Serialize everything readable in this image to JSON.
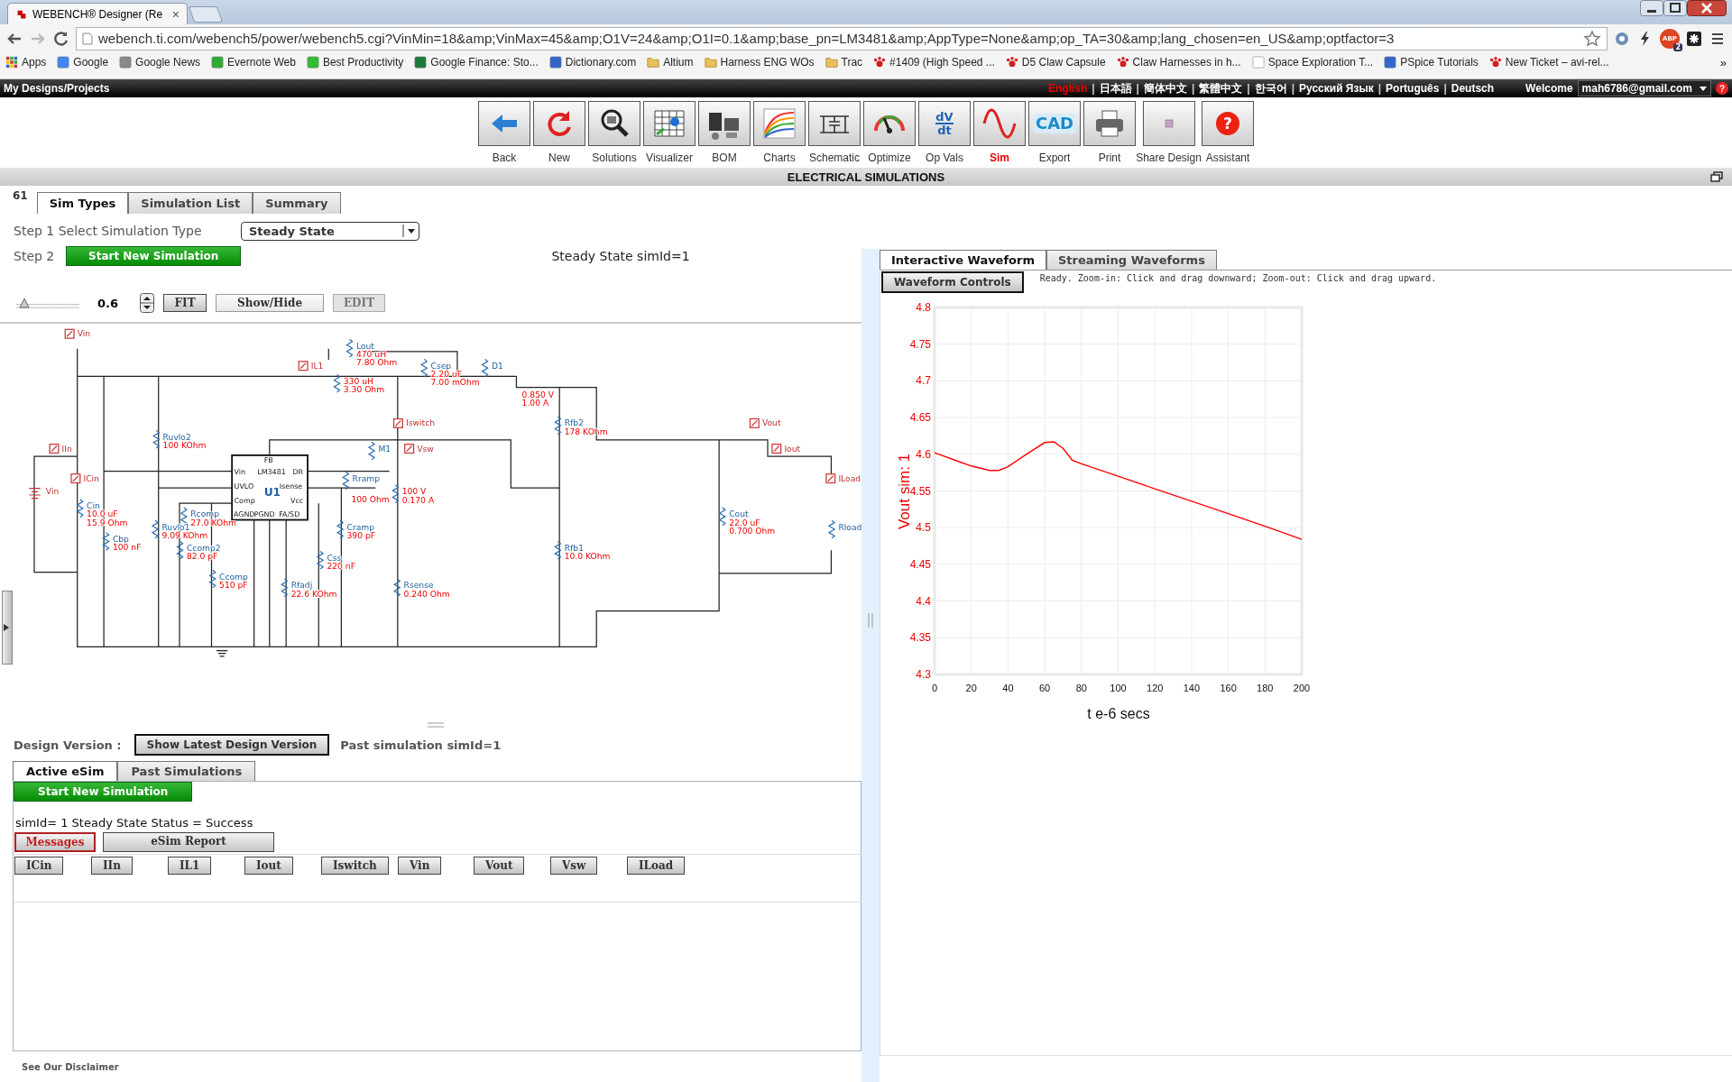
{
  "browser": {
    "tab_title": "WEBENCH® Designer (Re",
    "tab_close": "×",
    "url": "webench.ti.com/webench5/power/webench5.cgi?VinMin=18&amp;VinMax=45&amp;O1V=24&amp;O1I=0.1&amp;base_pn=LM3481&amp;AppType=None&amp;op_TA=30&amp;lang_chosen=en_US&amp;optfactor=3",
    "adblock_label": "ABP",
    "adblock_count": "2",
    "bookmarks": [
      {
        "label": "Apps"
      },
      {
        "label": "Google"
      },
      {
        "label": "Google News"
      },
      {
        "label": "Evernote Web"
      },
      {
        "label": "Best Productivity"
      },
      {
        "label": "Google Finance: Sto..."
      },
      {
        "label": "Dictionary.com"
      },
      {
        "label": "Altium"
      },
      {
        "label": "Harness ENG WOs"
      },
      {
        "label": "Trac"
      },
      {
        "label": "#1409 (High Speed ..."
      },
      {
        "label": "D5 Claw Capsule"
      },
      {
        "label": "Claw Harnesses in h..."
      },
      {
        "label": "Space Exploration T..."
      },
      {
        "label": "PSpice Tutorials"
      },
      {
        "label": "New Ticket – avi-rel..."
      }
    ],
    "bookmarks_more": "»"
  },
  "top_bar": {
    "title": "My Designs/Projects",
    "separator": "|",
    "languages": [
      {
        "label": "English",
        "selected": true
      },
      {
        "label": "日本語",
        "selected": false
      },
      {
        "label": "簡体中文",
        "selected": false
      },
      {
        "label": "繁體中文",
        "selected": false
      },
      {
        "label": "한국어",
        "selected": false
      },
      {
        "label": "Русский Язык",
        "selected": false
      },
      {
        "label": "Português",
        "selected": false
      },
      {
        "label": "Deutsch",
        "selected": false
      }
    ],
    "welcome": "Welcome",
    "account": "mah6786@gmail.com",
    "help_glyph": "?"
  },
  "toolbar": [
    {
      "label": "Back",
      "selected": false
    },
    {
      "label": "New",
      "selected": false
    },
    {
      "label": "Solutions",
      "selected": false
    },
    {
      "label": "Visualizer",
      "selected": false
    },
    {
      "label": "BOM",
      "selected": false
    },
    {
      "label": "Charts",
      "selected": false
    },
    {
      "label": "Schematic",
      "selected": false
    },
    {
      "label": "Optimize",
      "selected": false
    },
    {
      "label": "Op Vals",
      "selected": false,
      "glyph": [
        "dV",
        "dt"
      ]
    },
    {
      "label": "Sim",
      "selected": true
    },
    {
      "label": "Export",
      "selected": false,
      "glyph": [
        "CAD"
      ]
    },
    {
      "label": "Print",
      "selected": false
    },
    {
      "label": "Share Design",
      "selected": false
    },
    {
      "label": "Assistant",
      "selected": false,
      "glyph": [
        "?"
      ]
    }
  ],
  "section_title": "ELECTRICAL SIMULATIONS",
  "left": {
    "badge": "61",
    "tabs": [
      {
        "label": "Sim Types",
        "selected": true
      },
      {
        "label": "Simulation List",
        "selected": false
      },
      {
        "label": "Summary",
        "selected": false
      }
    ],
    "step1_label": "Step 1 Select Simulation Type",
    "sim_type": "Steady State",
    "step2_label": "Step 2",
    "start_button": "Start New Simulation",
    "sim_info": "Steady State simId=1",
    "zoom": {
      "level": 0.05,
      "value": "0.6"
    },
    "buttons": [
      {
        "label": "FIT",
        "disabled": false
      },
      {
        "label": "Show/Hide",
        "disabled": false
      },
      {
        "label": "EDIT",
        "disabled": true
      }
    ]
  },
  "schematic": {
    "chip": {
      "name": "U1",
      "part": "LM3481",
      "pins": [
        "FB",
        "Vin",
        "DR",
        "UVLO",
        "Isense",
        "Comp",
        "Vcc",
        "AGND",
        "PGND",
        "FA/SD"
      ]
    },
    "parts": [
      {
        "kind": "probe",
        "name": "Vin"
      },
      {
        "kind": "part",
        "name": "Lout",
        "values": [
          "470 uH",
          "7.80 Ohm"
        ]
      },
      {
        "kind": "probe",
        "name": "IL1"
      },
      {
        "kind": "part",
        "values": [
          "330 uH",
          "3.30 Ohm"
        ]
      },
      {
        "kind": "part",
        "name": "Csep",
        "values": [
          "2.20 uF",
          "7.00 mOhm"
        ]
      },
      {
        "kind": "part",
        "name": "D1",
        "values": [
          "0.850 V",
          "1.00 A"
        ]
      },
      {
        "kind": "probe",
        "name": "Iswitch"
      },
      {
        "kind": "part",
        "name": "Rfb2",
        "values": [
          "178 KOhm"
        ]
      },
      {
        "kind": "probe",
        "name": "Vout"
      },
      {
        "kind": "part",
        "name": "Ruvlo2",
        "values": [
          "100 KOhm"
        ]
      },
      {
        "kind": "probe",
        "name": "IIn"
      },
      {
        "kind": "part",
        "name": "M1"
      },
      {
        "kind": "probe",
        "name": "Vsw"
      },
      {
        "kind": "probe",
        "name": "Iout"
      },
      {
        "kind": "probe",
        "name": "ICin"
      },
      {
        "kind": "part",
        "name": "Rramp",
        "values": [
          "100 Ohm"
        ]
      },
      {
        "kind": "probe",
        "name": "ILoad"
      },
      {
        "kind": "source",
        "name": "Vin"
      },
      {
        "kind": "part",
        "values": [
          "100 V",
          "0.170 A"
        ]
      },
      {
        "kind": "part",
        "name": "Cin",
        "values": [
          "10.0 uF",
          "15.9 Ohm"
        ]
      },
      {
        "kind": "part",
        "name": "Rcomp",
        "values": [
          "27.0 KOhm"
        ]
      },
      {
        "kind": "part",
        "name": "Cout",
        "values": [
          "22.0 uF",
          "0.700 Ohm"
        ]
      },
      {
        "kind": "part",
        "name": "Ruvlo1",
        "values": [
          "9.09 KOhm"
        ]
      },
      {
        "kind": "part",
        "name": "Cramp",
        "values": [
          "390 pF"
        ]
      },
      {
        "kind": "part",
        "name": "Rload"
      },
      {
        "kind": "part",
        "name": "Cbp",
        "values": [
          "100 nF"
        ]
      },
      {
        "kind": "part",
        "name": "Ccomp2",
        "values": [
          "82.0 pF"
        ]
      },
      {
        "kind": "part",
        "name": "Rfb1",
        "values": [
          "10.0 KOhm"
        ]
      },
      {
        "kind": "part",
        "name": "Css",
        "values": [
          "220 nF"
        ]
      },
      {
        "kind": "part",
        "name": "Ccomp",
        "values": [
          "510 pF"
        ]
      },
      {
        "kind": "part",
        "name": "Rfadj",
        "values": [
          "22.6 KOhm"
        ]
      },
      {
        "kind": "part",
        "name": "Rsense",
        "values": [
          "0.240 Ohm"
        ]
      }
    ]
  },
  "design_version": {
    "label": "Design Version :",
    "button": "Show Latest Design Version",
    "past_info": "Past simulation simId=1"
  },
  "esim": {
    "tabs": [
      {
        "label": "Active eSim",
        "selected": true
      },
      {
        "label": "Past Simulations",
        "selected": false
      }
    ],
    "start_button": "Start New Simulation",
    "status": "simId= 1 Steady State Status = Success",
    "views": [
      {
        "label": "Messages",
        "selected": true
      },
      {
        "label": "eSim Report",
        "selected": false
      }
    ],
    "probes": [
      "ICin",
      "IIn",
      "IL1",
      "Iout",
      "Iswitch",
      "Vin",
      "Vout",
      "Vsw",
      "ILoad"
    ]
  },
  "disclaimer": "See Our Disclaimer",
  "right": {
    "tabs": [
      {
        "label": "Interactive Waveform",
        "selected": true
      },
      {
        "label": "Streaming Waveforms",
        "selected": false
      }
    ],
    "controls_button": "Waveform Controls",
    "hint": "Ready.  Zoom-in: Click and drag downward; Zoom-out: Click and drag upward.",
    "chart_data": {
      "type": "line",
      "xlabel": "t e-6 secs",
      "ylabel": "Vout sim:  1",
      "grid": true,
      "x": [
        0,
        10,
        20,
        30,
        35,
        40,
        50,
        60,
        65,
        70,
        75,
        80,
        100,
        120,
        140,
        160,
        180,
        200
      ],
      "series": [
        {
          "color": "#ff0000",
          "values": [
            4.602,
            4.593,
            4.584,
            4.578,
            4.578,
            4.583,
            4.6,
            4.616,
            4.617,
            4.608,
            4.592,
            4.587,
            4.57,
            4.553,
            4.536,
            4.519,
            4.502,
            4.484
          ]
        }
      ],
      "xlim": [
        0,
        200
      ],
      "ylim": [
        4.3,
        4.8
      ],
      "xticks": [
        0,
        20,
        40,
        60,
        80,
        100,
        120,
        140,
        160,
        180,
        200
      ],
      "yticks": [
        4.3,
        4.35,
        4.4,
        4.45,
        4.5,
        4.55,
        4.6,
        4.65,
        4.7,
        4.75,
        4.8
      ]
    }
  }
}
